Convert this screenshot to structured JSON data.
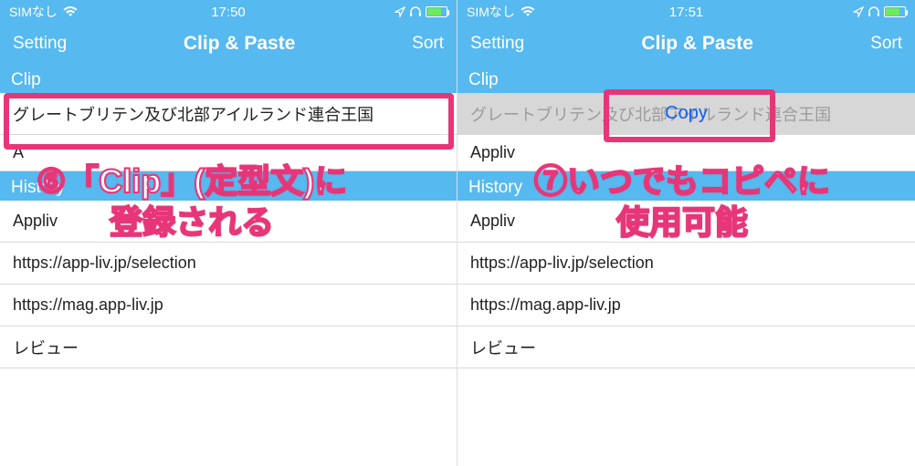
{
  "left": {
    "status": {
      "sim": "SIMなし",
      "time": "17:50"
    },
    "nav": {
      "setting": "Setting",
      "title": "Clip & Paste",
      "sort": "Sort"
    },
    "sections": {
      "clip": "Clip",
      "history": "History"
    },
    "clip_items": [
      "グレートブリテン及び北部アイルランド連合王国"
    ],
    "partial_item": "A",
    "history_items": [
      "Appliv",
      "https://app-liv.jp/selection",
      "https://mag.app-liv.jp",
      "レビュー"
    ],
    "annotation": "⑥「Clip」(定型文)に\n登録される"
  },
  "right": {
    "status": {
      "sim": "SIMなし",
      "time": "17:51"
    },
    "nav": {
      "setting": "Setting",
      "title": "Clip & Paste",
      "sort": "Sort"
    },
    "sections": {
      "clip": "Clip",
      "history": "History"
    },
    "clip_items": [
      "グレートブリテン及び北部アイルランド連合王国"
    ],
    "copy_label": "Copy",
    "partial_item": "Appliv",
    "history_items": [
      "Appliv",
      "https://app-liv.jp/selection",
      "https://mag.app-liv.jp",
      "レビュー"
    ],
    "annotation": "⑦いつでもコピペに\n使用可能"
  }
}
